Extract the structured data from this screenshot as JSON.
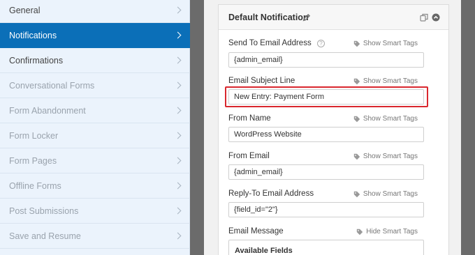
{
  "sidebar": {
    "items": [
      {
        "label": "General",
        "state": "normal"
      },
      {
        "label": "Notifications",
        "state": "active"
      },
      {
        "label": "Confirmations",
        "state": "normal"
      },
      {
        "label": "Conversational Forms",
        "state": "muted"
      },
      {
        "label": "Form Abandonment",
        "state": "muted"
      },
      {
        "label": "Form Locker",
        "state": "muted"
      },
      {
        "label": "Form Pages",
        "state": "muted"
      },
      {
        "label": "Offline Forms",
        "state": "muted"
      },
      {
        "label": "Post Submissions",
        "state": "muted"
      },
      {
        "label": "Save and Resume",
        "state": "muted"
      }
    ],
    "active_color": "#0b6fb8"
  },
  "notification": {
    "title": "Default Notification",
    "fields": [
      {
        "label": "Send To Email Address",
        "value": "{admin_email}",
        "smart_tags": "Show Smart Tags",
        "has_help": true
      },
      {
        "label": "Email Subject Line",
        "value": "New Entry: Payment Form",
        "smart_tags": "Show Smart Tags",
        "highlighted": true
      },
      {
        "label": "From Name",
        "value": "WordPress Website",
        "smart_tags": "Show Smart Tags"
      },
      {
        "label": "From Email",
        "value": "{admin_email}",
        "smart_tags": "Show Smart Tags"
      },
      {
        "label": "Reply-To Email Address",
        "value": "{field_id=\"2\"}",
        "smart_tags": "Show Smart Tags"
      }
    ],
    "message": {
      "label": "Email Message",
      "smart_tags": "Hide Smart Tags",
      "available_fields": "Available Fields"
    },
    "highlight_color": "#d9272e"
  }
}
